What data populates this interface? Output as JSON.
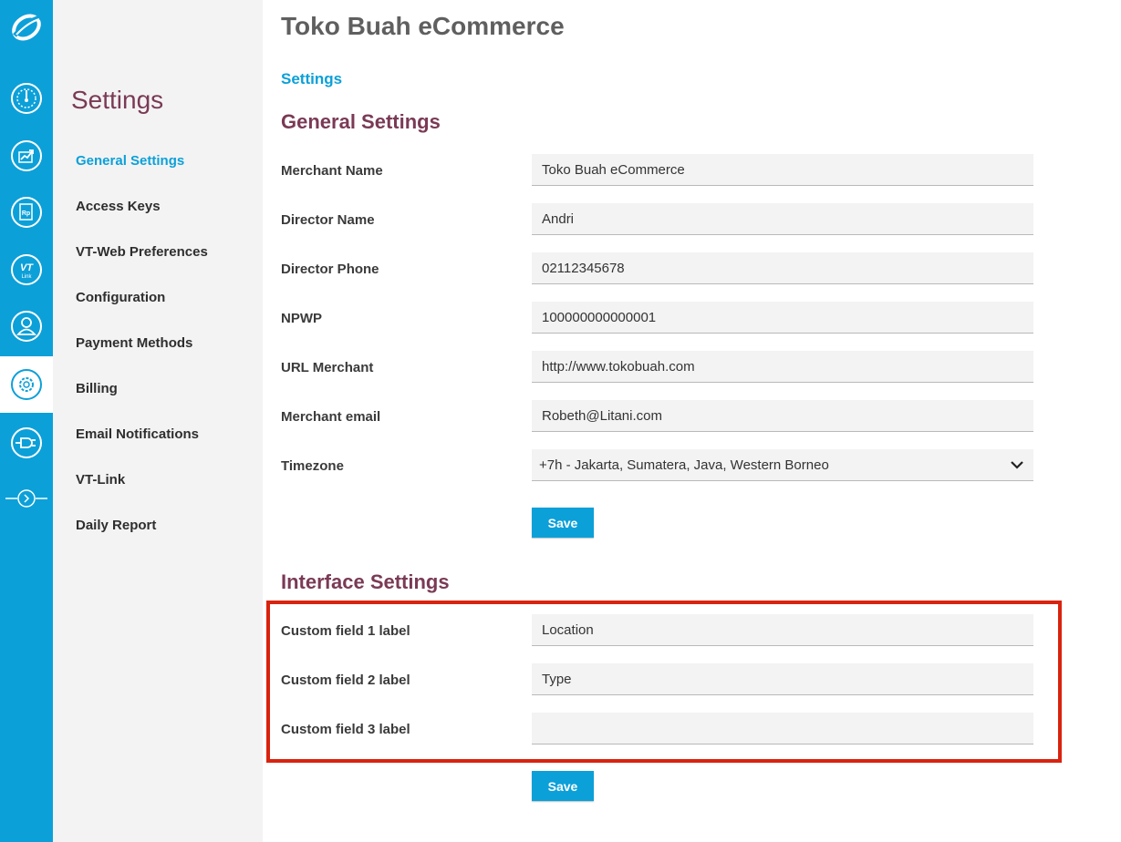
{
  "app": {
    "title": "Toko Buah eCommerce"
  },
  "breadcrumb": {
    "label": "Settings"
  },
  "rail": {
    "items": [
      {
        "icon": "dashboard-gauge-icon"
      },
      {
        "icon": "transactions-trend-icon"
      },
      {
        "icon": "invoice-rp-icon"
      },
      {
        "icon": "vt-link-icon",
        "label": "VT",
        "sublabel": "Link"
      },
      {
        "icon": "user-profile-icon"
      },
      {
        "icon": "settings-gear-icon",
        "active": true
      },
      {
        "icon": "plug-integration-icon"
      },
      {
        "icon": "expand-arrow-icon"
      }
    ]
  },
  "subnav": {
    "title": "Settings",
    "items": [
      {
        "label": "General Settings",
        "active": true
      },
      {
        "label": "Access Keys"
      },
      {
        "label": "VT-Web Preferences"
      },
      {
        "label": "Configuration"
      },
      {
        "label": "Payment Methods"
      },
      {
        "label": "Billing"
      },
      {
        "label": "Email Notifications"
      },
      {
        "label": "VT-Link"
      },
      {
        "label": "Daily Report"
      }
    ]
  },
  "general": {
    "title": "General Settings",
    "merchant_name": {
      "label": "Merchant Name",
      "value": "Toko Buah eCommerce"
    },
    "director_name": {
      "label": "Director Name",
      "value": "Andri"
    },
    "director_phone": {
      "label": "Director Phone",
      "value": "02112345678"
    },
    "npwp": {
      "label": "NPWP",
      "value": "100000000000001"
    },
    "url_merchant": {
      "label": "URL Merchant",
      "value": "http://www.tokobuah.com"
    },
    "merchant_email": {
      "label": "Merchant email",
      "value": "Robeth@Litani.com"
    },
    "timezone": {
      "label": "Timezone",
      "value": "+7h - Jakarta, Sumatera, Java, Western Borneo"
    },
    "save_label": "Save"
  },
  "interface": {
    "title": "Interface Settings",
    "custom1": {
      "label": "Custom field 1 label",
      "value": "Location"
    },
    "custom2": {
      "label": "Custom field 2 label",
      "value": "Type"
    },
    "custom3": {
      "label": "Custom field 3 label",
      "value": ""
    },
    "save_label": "Save"
  },
  "colors": {
    "brand_blue": "#0ca0d9",
    "heading_plum": "#7a3a55",
    "highlight_red": "#d9230f",
    "sidebar_bg": "#f3f3f3"
  }
}
